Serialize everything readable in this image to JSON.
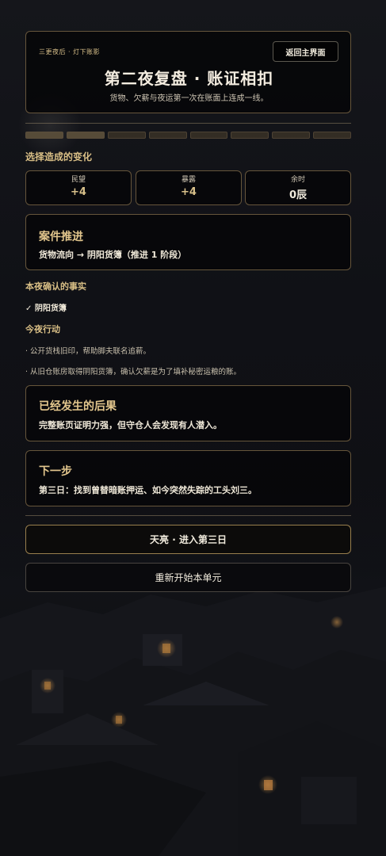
{
  "header": {
    "kicker": "三更夜后 · 灯下账影",
    "home_button": "返回主界面",
    "title": "第二夜复盘 · 账证相扣",
    "subtitle": "货物、欠薪与夜运第一次在账面上连成一线。"
  },
  "progress": {
    "total": 8,
    "completed": 2
  },
  "changes": {
    "heading": "选择造成的变化",
    "stats": [
      {
        "label": "民望",
        "value": "+4",
        "color": "#d8c08a"
      },
      {
        "label": "暴露",
        "value": "+4",
        "color": "#d8c08a"
      },
      {
        "label": "余时",
        "value": "0辰",
        "color": "#f1ebdd"
      }
    ]
  },
  "case_progress": {
    "title": "案件推进",
    "body": "货物流向 → 阴阳货簿（推进 1 阶段）"
  },
  "facts": {
    "heading": "本夜确认的事实",
    "items": [
      "✓ 阴阳货簿"
    ]
  },
  "actions": {
    "heading": "今夜行动",
    "items": [
      "· 公开货栈旧印，帮助脚夫联名追薪。",
      "· 从旧仓账房取得阴阳货簿，确认欠薪是为了填补秘密运粮的账。"
    ]
  },
  "consequence": {
    "title": "已经发生的后果",
    "body": "完整账页证明力强，但守仓人会发现有人潜入。"
  },
  "next_step": {
    "title": "下一步",
    "body": "第三日：找到曾替暗账押运、如今突然失踪的工头刘三。"
  },
  "buttons": {
    "continue": "天亮 · 进入第三日",
    "restart": "重新开始本单元"
  }
}
